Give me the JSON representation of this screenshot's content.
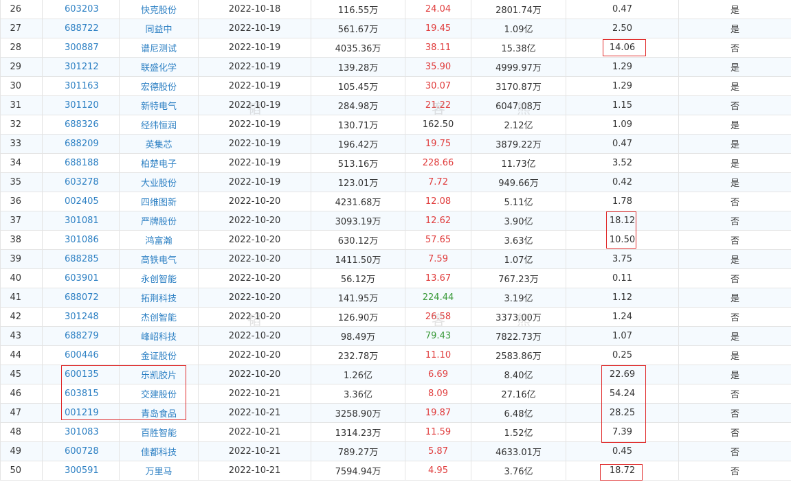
{
  "accent_red": "#e03c3c",
  "accent_green": "#3b9a3b",
  "link_blue": "#2b7fc3",
  "watermark": [
    "韬",
    "客",
    "熊"
  ],
  "rows": [
    {
      "n": "26",
      "code": "603203",
      "name": "快克股份",
      "date": "2022-10-18",
      "amount": "116.55万",
      "price": "24.04",
      "pc": "red",
      "cap": "2801.74万",
      "ratio": "0.47",
      "flag": "是"
    },
    {
      "n": "27",
      "code": "688722",
      "name": "同益中",
      "date": "2022-10-19",
      "amount": "561.67万",
      "price": "19.45",
      "pc": "red",
      "cap": "1.09亿",
      "ratio": "2.50",
      "flag": "是"
    },
    {
      "n": "28",
      "code": "300887",
      "name": "谱尼测试",
      "date": "2022-10-19",
      "amount": "4035.36万",
      "price": "38.11",
      "pc": "red",
      "cap": "15.38亿",
      "ratio": "14.06",
      "flag": "否"
    },
    {
      "n": "29",
      "code": "301212",
      "name": "联盛化学",
      "date": "2022-10-19",
      "amount": "139.28万",
      "price": "35.90",
      "pc": "red",
      "cap": "4999.97万",
      "ratio": "1.29",
      "flag": "是"
    },
    {
      "n": "30",
      "code": "301163",
      "name": "宏德股份",
      "date": "2022-10-19",
      "amount": "105.45万",
      "price": "30.07",
      "pc": "red",
      "cap": "3170.87万",
      "ratio": "1.29",
      "flag": "是"
    },
    {
      "n": "31",
      "code": "301120",
      "name": "新特电气",
      "date": "2022-10-19",
      "amount": "284.98万",
      "price": "21.22",
      "pc": "red",
      "cap": "6047.08万",
      "ratio": "1.15",
      "flag": "否"
    },
    {
      "n": "32",
      "code": "688326",
      "name": "经纬恒润",
      "date": "2022-10-19",
      "amount": "130.71万",
      "price": "162.50",
      "pc": "",
      "cap": "2.12亿",
      "ratio": "1.09",
      "flag": "是"
    },
    {
      "n": "33",
      "code": "688209",
      "name": "英集芯",
      "date": "2022-10-19",
      "amount": "196.42万",
      "price": "19.75",
      "pc": "red",
      "cap": "3879.22万",
      "ratio": "0.47",
      "flag": "是"
    },
    {
      "n": "34",
      "code": "688188",
      "name": "柏楚电子",
      "date": "2022-10-19",
      "amount": "513.16万",
      "price": "228.66",
      "pc": "red",
      "cap": "11.73亿",
      "ratio": "3.52",
      "flag": "是"
    },
    {
      "n": "35",
      "code": "603278",
      "name": "大业股份",
      "date": "2022-10-19",
      "amount": "123.01万",
      "price": "7.72",
      "pc": "red",
      "cap": "949.66万",
      "ratio": "0.42",
      "flag": "是"
    },
    {
      "n": "36",
      "code": "002405",
      "name": "四维图新",
      "date": "2022-10-20",
      "amount": "4231.68万",
      "price": "12.08",
      "pc": "red",
      "cap": "5.11亿",
      "ratio": "1.78",
      "flag": "否"
    },
    {
      "n": "37",
      "code": "301081",
      "name": "严牌股份",
      "date": "2022-10-20",
      "amount": "3093.19万",
      "price": "12.62",
      "pc": "red",
      "cap": "3.90亿",
      "ratio": "18.12",
      "flag": "否"
    },
    {
      "n": "38",
      "code": "301086",
      "name": "鸿富瀚",
      "date": "2022-10-20",
      "amount": "630.12万",
      "price": "57.65",
      "pc": "red",
      "cap": "3.63亿",
      "ratio": "10.50",
      "flag": "否"
    },
    {
      "n": "39",
      "code": "688285",
      "name": "高铁电气",
      "date": "2022-10-20",
      "amount": "1411.50万",
      "price": "7.59",
      "pc": "red",
      "cap": "1.07亿",
      "ratio": "3.75",
      "flag": "是"
    },
    {
      "n": "40",
      "code": "603901",
      "name": "永创智能",
      "date": "2022-10-20",
      "amount": "56.12万",
      "price": "13.67",
      "pc": "red",
      "cap": "767.23万",
      "ratio": "0.11",
      "flag": "否"
    },
    {
      "n": "41",
      "code": "688072",
      "name": "拓荆科技",
      "date": "2022-10-20",
      "amount": "141.95万",
      "price": "224.44",
      "pc": "green",
      "cap": "3.19亿",
      "ratio": "1.12",
      "flag": "是"
    },
    {
      "n": "42",
      "code": "301248",
      "name": "杰创智能",
      "date": "2022-10-20",
      "amount": "126.90万",
      "price": "26.58",
      "pc": "red",
      "cap": "3373.00万",
      "ratio": "1.24",
      "flag": "否"
    },
    {
      "n": "43",
      "code": "688279",
      "name": "峰岹科技",
      "date": "2022-10-20",
      "amount": "98.49万",
      "price": "79.43",
      "pc": "green",
      "cap": "7822.73万",
      "ratio": "1.07",
      "flag": "是"
    },
    {
      "n": "44",
      "code": "600446",
      "name": "金证股份",
      "date": "2022-10-20",
      "amount": "232.78万",
      "price": "11.10",
      "pc": "red",
      "cap": "2583.86万",
      "ratio": "0.25",
      "flag": "是"
    },
    {
      "n": "45",
      "code": "600135",
      "name": "乐凯胶片",
      "date": "2022-10-20",
      "amount": "1.26亿",
      "price": "6.69",
      "pc": "red",
      "cap": "8.40亿",
      "ratio": "22.69",
      "flag": "是"
    },
    {
      "n": "46",
      "code": "603815",
      "name": "交建股份",
      "date": "2022-10-21",
      "amount": "3.36亿",
      "price": "8.09",
      "pc": "red",
      "cap": "27.16亿",
      "ratio": "54.24",
      "flag": "否"
    },
    {
      "n": "47",
      "code": "001219",
      "name": "青岛食品",
      "date": "2022-10-21",
      "amount": "3258.90万",
      "price": "19.87",
      "pc": "red",
      "cap": "6.48亿",
      "ratio": "28.25",
      "flag": "否"
    },
    {
      "n": "48",
      "code": "301083",
      "name": "百胜智能",
      "date": "2022-10-21",
      "amount": "1314.23万",
      "price": "11.59",
      "pc": "red",
      "cap": "1.52亿",
      "ratio": "7.39",
      "flag": "否"
    },
    {
      "n": "49",
      "code": "600728",
      "name": "佳都科技",
      "date": "2022-10-21",
      "amount": "789.27万",
      "price": "5.87",
      "pc": "red",
      "cap": "4633.01万",
      "ratio": "0.45",
      "flag": "否"
    },
    {
      "n": "50",
      "code": "300591",
      "name": "万里马",
      "date": "2022-10-21",
      "amount": "7594.94万",
      "price": "4.95",
      "pc": "red",
      "cap": "3.76亿",
      "ratio": "18.72",
      "flag": "否"
    }
  ]
}
